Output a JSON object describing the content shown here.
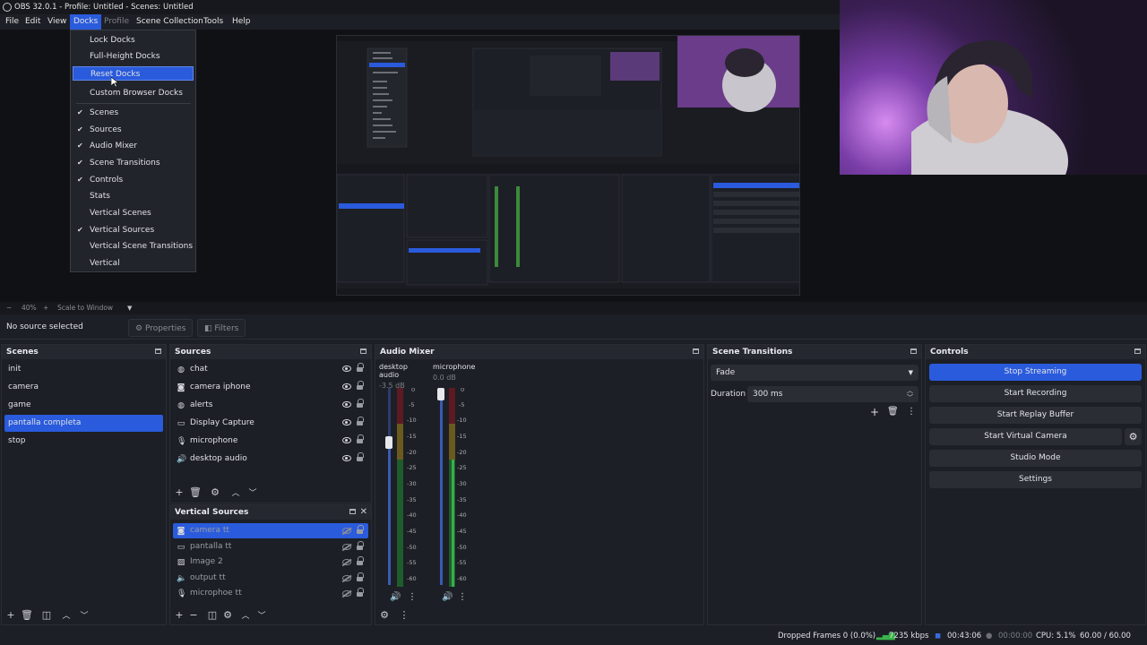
{
  "window": {
    "title": "OBS 32.0.1 - Profile: Untitled - Scenes: Untitled"
  },
  "menu": {
    "file": "File",
    "edit": "Edit",
    "view": "View",
    "docks": "Docks",
    "profile": "Profile",
    "scene_collection": "Scene Collection",
    "tools": "Tools",
    "help": "Help"
  },
  "docks_menu": {
    "lock": "Lock Docks",
    "full_height": "Full-Height Docks",
    "reset": "Reset Docks",
    "custom_browser": "Custom Browser Docks",
    "items": [
      {
        "label": "Scenes",
        "checked": true
      },
      {
        "label": "Sources",
        "checked": true
      },
      {
        "label": "Audio Mixer",
        "checked": true
      },
      {
        "label": "Scene Transitions",
        "checked": true
      },
      {
        "label": "Controls",
        "checked": true
      },
      {
        "label": "Stats",
        "checked": false
      },
      {
        "label": "Vertical Scenes",
        "checked": false
      },
      {
        "label": "Vertical Sources",
        "checked": true
      },
      {
        "label": "Vertical Scene Transitions",
        "checked": false
      },
      {
        "label": "Vertical",
        "checked": false
      }
    ]
  },
  "zoom": {
    "level": "40%",
    "mode": "Scale to Window"
  },
  "source_bar": {
    "status": "No source selected",
    "properties": "Properties",
    "filters": "Filters"
  },
  "scenes": {
    "title": "Scenes",
    "items": [
      "init",
      "camera",
      "game",
      "pantalla completa",
      "stop"
    ],
    "selected": "pantalla completa"
  },
  "sources": {
    "title": "Sources",
    "items": [
      {
        "label": "chat",
        "icon": "globe-icon"
      },
      {
        "label": "camera iphone",
        "icon": "camera-icon"
      },
      {
        "label": "alerts",
        "icon": "globe-icon"
      },
      {
        "label": "Display Capture",
        "icon": "monitor-icon"
      },
      {
        "label": "microphone",
        "icon": "microphone-icon"
      },
      {
        "label": "desktop audio",
        "icon": "speaker-icon"
      }
    ]
  },
  "vertical_sources": {
    "title": "Vertical Sources",
    "items": [
      {
        "label": "camera tt",
        "icon": "camera-icon"
      },
      {
        "label": "pantalla tt",
        "icon": "monitor-icon"
      },
      {
        "label": "Image 2",
        "icon": "image-icon"
      },
      {
        "label": "output tt",
        "icon": "speaker-icon"
      },
      {
        "label": "microphoe tt",
        "icon": "microphone-icon"
      }
    ]
  },
  "audio_mixer": {
    "title": "Audio Mixer",
    "channels": [
      {
        "name": "desktop audio",
        "db": "-3.5 dB",
        "fader": 0.62
      },
      {
        "name": "microphone",
        "db": "0.0 dB",
        "fader": 0.95
      }
    ],
    "ticks": [
      "0",
      "-5",
      "-10",
      "-15",
      "-20",
      "-25",
      "-30",
      "-35",
      "-40",
      "-45",
      "-50",
      "-55",
      "-60"
    ]
  },
  "transitions": {
    "title": "Scene Transitions",
    "selected": "Fade",
    "duration_label": "Duration",
    "duration_value": "300 ms"
  },
  "controls": {
    "title": "Controls",
    "stop_streaming": "Stop Streaming",
    "start_recording": "Start Recording",
    "start_replay": "Start Replay Buffer",
    "start_virtual": "Start Virtual Camera",
    "studio_mode": "Studio Mode",
    "settings": "Settings"
  },
  "status": {
    "dropped": "Dropped Frames 0 (0.0%)",
    "bitrate": "7235 kbps",
    "stream_time": "00:43:06",
    "rec_time": "00:00:00",
    "cpu": "CPU: 5.1%",
    "fps": "60.00 / 60.00 FPS"
  },
  "colors": {
    "accent": "#2a5bdc",
    "bg": "#1d1f26",
    "panel": "#262830"
  }
}
